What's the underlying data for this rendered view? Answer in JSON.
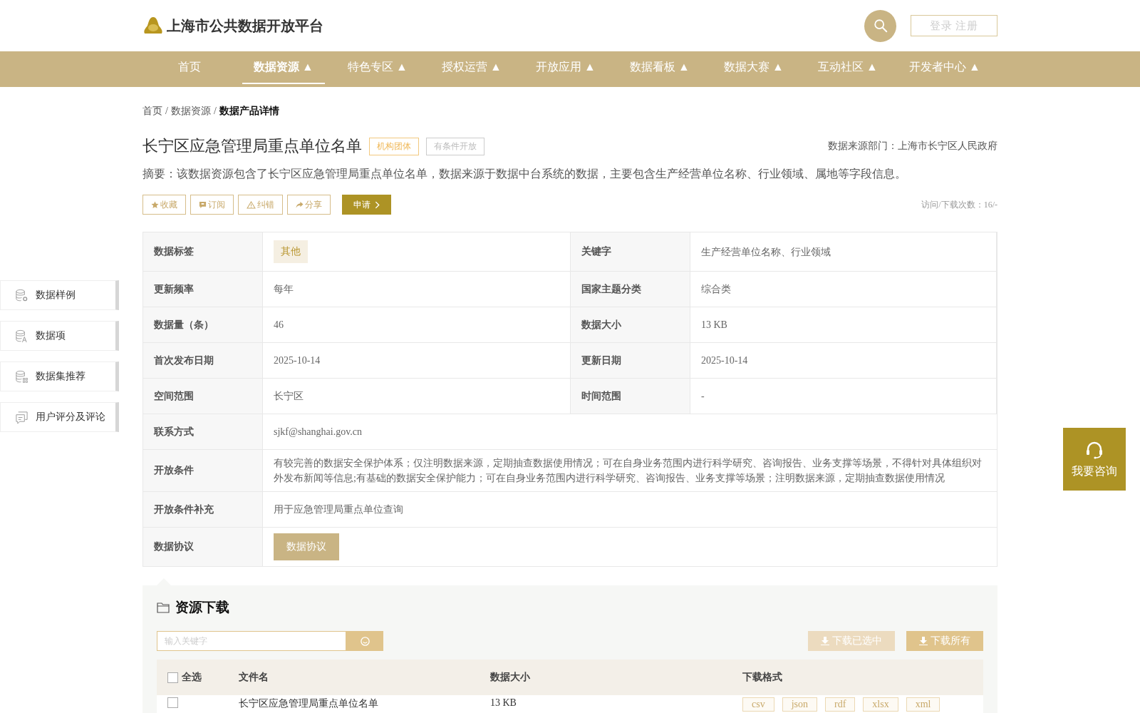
{
  "site": {
    "title": "上海市公共数据开放平台",
    "login": "登录 注册"
  },
  "nav": [
    {
      "label": "首页",
      "selected": false
    },
    {
      "label": "数据资源 ▲",
      "selected": true
    },
    {
      "label": "特色专区 ▲",
      "selected": false
    },
    {
      "label": "授权运营 ▲",
      "selected": false
    },
    {
      "label": "开放应用 ▲",
      "selected": false
    },
    {
      "label": "数据看板 ▲",
      "selected": false
    },
    {
      "label": "数据大赛 ▲",
      "selected": false
    },
    {
      "label": "互动社区 ▲",
      "selected": false
    },
    {
      "label": "开发者中心 ▲",
      "selected": false
    }
  ],
  "breadcrumb_separator": "/",
  "breadcrumb": [
    {
      "label": "首页",
      "current": false
    },
    {
      "label": "数据资源",
      "current": false
    },
    {
      "label": "数据产品详情",
      "current": true
    }
  ],
  "dataset": {
    "title": "长宁区应急管理局重点单位名单",
    "tags": [
      {
        "label": "机构团体",
        "kind": "category"
      },
      {
        "label": "有条件开放",
        "kind": "access"
      }
    ],
    "source": "数据来源部门：上海市长宁区人民政府",
    "summary": "摘要：该数据资源包含了长宁区应急管理局重点单位名单，数据来源于数据中台系统的数据，主要包含生产经营单位名称、行业领域、属地等字段信息。",
    "actions": [
      {
        "label": "收藏",
        "kind": "favorite"
      },
      {
        "label": "订阅",
        "kind": "subscribe"
      },
      {
        "label": "纠错",
        "kind": "report"
      },
      {
        "label": "分享",
        "kind": "share"
      },
      {
        "label": "申请",
        "kind": "apply"
      }
    ],
    "visits": "访问/下载次数：16/-"
  },
  "details": [
    {
      "fields": [
        {
          "label": "数据标签",
          "value": "其他",
          "kind": "tag"
        },
        {
          "label": "关键字",
          "value": "生产经营单位名称、行业领域",
          "kind": "text"
        }
      ]
    },
    {
      "fields": [
        {
          "label": "更新频率",
          "value": "每年",
          "kind": "text"
        },
        {
          "label": "国家主题分类",
          "value": "综合类",
          "kind": "text"
        }
      ]
    },
    {
      "fields": [
        {
          "label": "数据量（条）",
          "value": "46",
          "kind": "text"
        },
        {
          "label": "数据大小",
          "value": "13 KB",
          "kind": "text"
        }
      ]
    },
    {
      "fields": [
        {
          "label": "首次发布日期",
          "value": "2025-10-14",
          "kind": "text"
        },
        {
          "label": "更新日期",
          "value": "2025-10-14",
          "kind": "text"
        }
      ]
    },
    {
      "fields": [
        {
          "label": "空间范围",
          "value": "长宁区",
          "kind": "text"
        },
        {
          "label": "时间范围",
          "value": "-",
          "kind": "text"
        }
      ]
    },
    {
      "fields": [
        {
          "label": "联系方式",
          "value": "sjkf@shanghai.gov.cn",
          "kind": "text"
        }
      ]
    },
    {
      "fields": [
        {
          "label": "开放条件",
          "value": "有较完善的数据安全保护体系；仅注明数据来源，定期抽查数据使用情况；可在自身业务范围内进行科学研究、咨询报告、业务支撑等场景，不得针对具体组织对外发布新闻等信息;有基础的数据安全保护能力；可在自身业务范围内进行科学研究、咨询报告、业务支撑等场景；注明数据来源，定期抽查数据使用情况",
          "kind": "text"
        }
      ]
    },
    {
      "fields": [
        {
          "label": "开放条件补充",
          "value": "用于应急管理局重点单位查询",
          "kind": "text"
        }
      ]
    },
    {
      "fields": [
        {
          "label": "数据协议",
          "value": "数据协议",
          "kind": "button"
        }
      ]
    }
  ],
  "side_nav": [
    {
      "label": "数据样例",
      "kind": "sample"
    },
    {
      "label": "数据项",
      "kind": "items"
    },
    {
      "label": "数据集推荐",
      "kind": "recommend"
    },
    {
      "label": "用户评分及评论",
      "kind": "comments"
    }
  ],
  "consult": "我要咨询",
  "downloads": {
    "title": "资源下载",
    "placeholder": "输入关键字",
    "actions": [
      {
        "label": "下载已选中",
        "disabled": true
      },
      {
        "label": "下载所有",
        "disabled": false
      }
    ],
    "select_all": {
      "label": "全选",
      "checked": false
    },
    "columns": [
      "文件名",
      "数据大小",
      "下载格式"
    ],
    "rows": [
      {
        "checked": false,
        "name": "长宁区应急管理局重点单位名单",
        "size": "13 KB",
        "formats": [
          "csv",
          "json",
          "rdf",
          "xlsx",
          "xml"
        ]
      }
    ]
  }
}
